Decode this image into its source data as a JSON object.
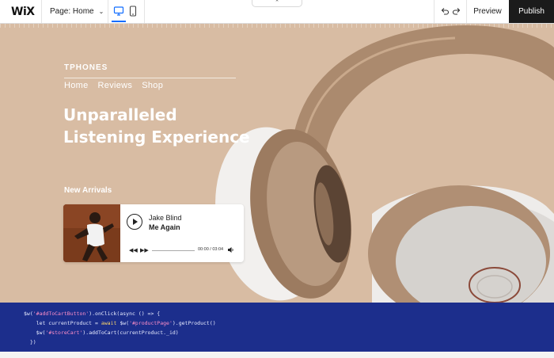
{
  "editor": {
    "logo": "WiX",
    "page_label": "Page: Home",
    "preview_label": "Preview",
    "publish_label": "Publish"
  },
  "site": {
    "brand": "TPHONES",
    "nav": [
      "Home",
      "Reviews",
      "Shop"
    ],
    "headline_line1": "Unparalleled",
    "headline_line2": "Listening Experience",
    "section_title": "New Arrivals",
    "player": {
      "artist": "Jake Blind",
      "song": "Me Again",
      "time": "00:00 / 03:04"
    }
  },
  "code": {
    "line1_a": "$w(",
    "line1_str": "'#addToCartButton'",
    "line1_b": ").onClick(async () => {",
    "line2_a": "    let currentProduct = ",
    "line2_kw": "await",
    "line2_b": " $w(",
    "line2_str": "'#productPage'",
    "line2_c": ").getProduct()",
    "line3_a": "    $w(",
    "line3_str": "'#storeCart'",
    "line3_b": ").addToCart(currentProduct._id)",
    "line4": "  })"
  },
  "colors": {
    "accent": "#116dff",
    "hero_bg": "#d8bca3",
    "code_bg": "#1c2e8c",
    "publish_bg": "#1b1b1b"
  }
}
